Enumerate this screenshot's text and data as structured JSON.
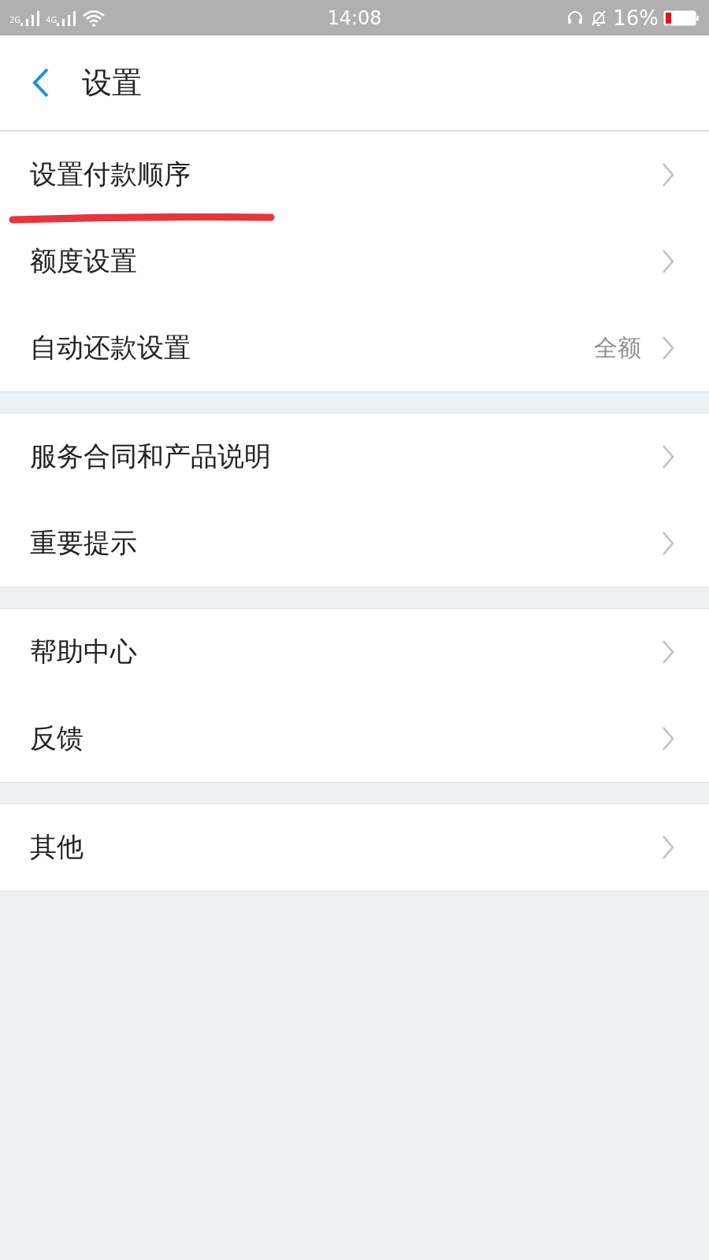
{
  "status_bar": {
    "signal_1": "2G",
    "signal_2": "4G",
    "time": "14:08",
    "battery": "16%"
  },
  "header": {
    "title": "设置"
  },
  "groups": [
    {
      "items": [
        {
          "label": "设置付款顺序",
          "underlined": true
        },
        {
          "label": "额度设置",
          "underlined": false
        },
        {
          "label": "自动还款设置",
          "value": "全额",
          "underlined": false
        }
      ]
    },
    {
      "items": [
        {
          "label": "服务合同和产品说明",
          "underlined": false
        },
        {
          "label": "重要提示",
          "underlined": false
        }
      ]
    },
    {
      "items": [
        {
          "label": "帮助中心",
          "underlined": false
        },
        {
          "label": "反馈",
          "underlined": false
        }
      ]
    },
    {
      "items": [
        {
          "label": "其他",
          "underlined": false
        }
      ]
    }
  ]
}
